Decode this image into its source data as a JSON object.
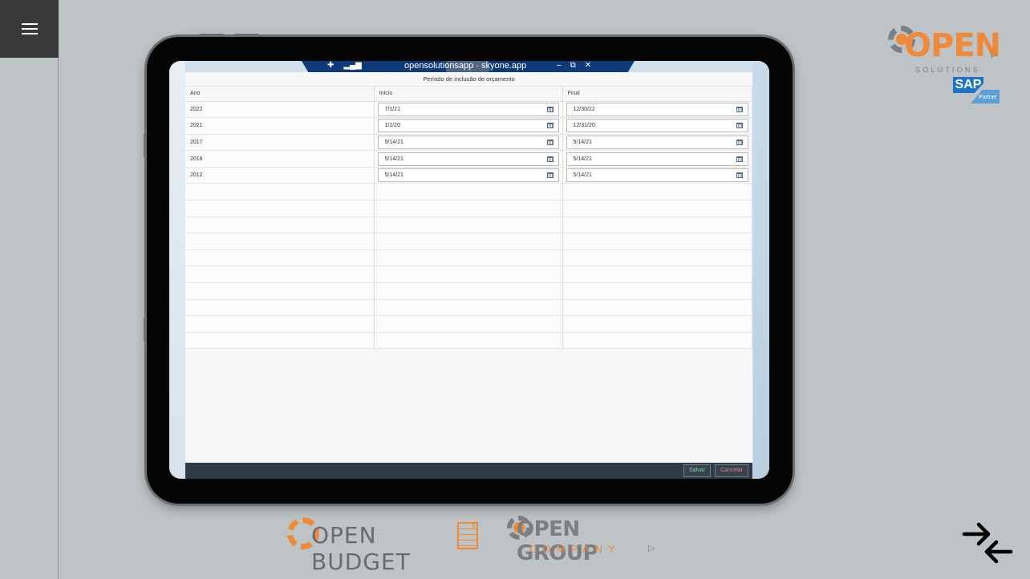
{
  "menu": {
    "icon": "hamburger-menu-icon"
  },
  "window": {
    "url_text": "opensolutionsapp · skyone.app",
    "icons": {
      "pin": "pin-icon",
      "signal": "signal-icon",
      "zoom": "zoom-icon",
      "minimize": "minimize-icon",
      "restore": "restore-icon",
      "close": "close-icon"
    }
  },
  "form": {
    "title": "Período de inclusão de orçamento",
    "columns": [
      "Ano",
      "Início",
      "Final"
    ],
    "rows": [
      {
        "ano": "2022",
        "inicio": "7/1/21",
        "final": "12/30/22"
      },
      {
        "ano": "2021",
        "inicio": "1/1/20",
        "final": "12/31/20"
      },
      {
        "ano": "2017",
        "inicio": "5/14/21",
        "final": "5/14/21"
      },
      {
        "ano": "2016",
        "inicio": "5/14/21",
        "final": "5/14/21"
      },
      {
        "ano": "2012",
        "inicio": "5/14/21",
        "final": "5/14/21"
      }
    ],
    "empty_rows": 10,
    "save_label": "Salvar",
    "cancel_label": "Cancelar"
  },
  "logos": {
    "open_word": "OPEN",
    "open_sub": "SOLUTIONS",
    "sap_word": "SAP",
    "sap_partner": "Partner",
    "budget_word": "OPEN BUDGET",
    "group_word": "OPEN GROUP",
    "group_sub": "COMPANY"
  },
  "colors": {
    "accent_orange": "#ef8a3b",
    "logo_gray": "#7b7f83",
    "titlebar_blue": "#0f3a78",
    "background": "#bec3c6"
  }
}
